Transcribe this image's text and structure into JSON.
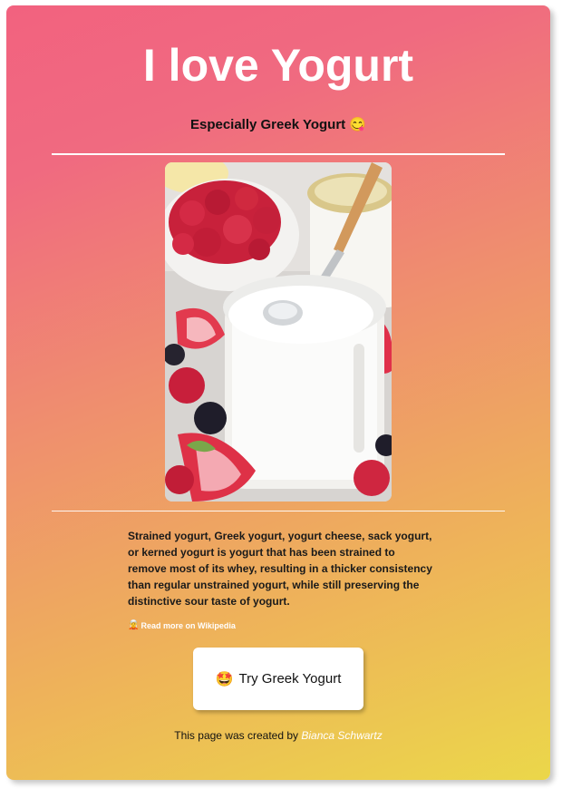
{
  "header": {
    "title": "I love Yogurt",
    "subtitle": "Especially Greek Yogurt",
    "subtitle_emoji": "😋"
  },
  "image": {
    "alt": "Greek yogurt in a glass jar with raspberries and strawberries"
  },
  "description": {
    "text": "Strained yogurt, Greek yogurt, yogurt cheese, sack yogurt, or kerned yogurt is yogurt that has been strained to remove most of its whey, resulting in a thicker consistency than regular unstrained yogurt, while still preserving the distinctive sour taste of yogurt."
  },
  "wiki_link": {
    "icon": "🧝",
    "label": "Read more on Wikipedia"
  },
  "cta": {
    "icon": "🤩",
    "label": "Try Greek Yogurt"
  },
  "footer": {
    "prefix": "This page was created by",
    "author": "Bianca Schwartz"
  },
  "colors": {
    "gradient_start": "#f2627f",
    "gradient_end": "#ebd74a",
    "title_color": "#ffffff",
    "link_color": "#ffffff"
  }
}
